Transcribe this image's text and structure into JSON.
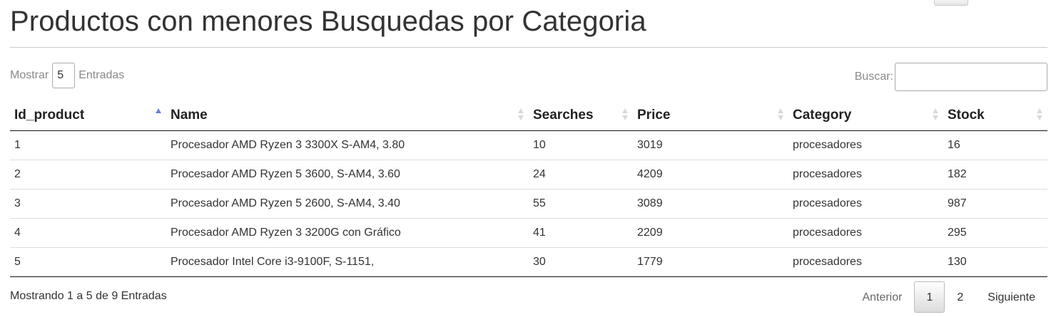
{
  "page": {
    "title": "Productos con menores Busquedas por Categoria"
  },
  "length_control": {
    "prefix": "Mostrar",
    "value": "5",
    "suffix": "Entradas"
  },
  "search": {
    "label": "Buscar:",
    "value": ""
  },
  "table": {
    "columns": [
      {
        "label": "Id_product",
        "sort": "asc"
      },
      {
        "label": "Name",
        "sort": "none"
      },
      {
        "label": "Searches",
        "sort": "none"
      },
      {
        "label": "Price",
        "sort": "none"
      },
      {
        "label": "Category",
        "sort": "none"
      },
      {
        "label": "Stock",
        "sort": "none"
      }
    ],
    "rows": [
      [
        "1",
        "Procesador AMD Ryzen 3 3300X S-AM4, 3.80",
        "10",
        "3019",
        "procesadores",
        "16"
      ],
      [
        "2",
        "Procesador AMD Ryzen 5 3600, S-AM4, 3.60",
        "24",
        "4209",
        "procesadores",
        "182"
      ],
      [
        "3",
        "Procesador AMD Ryzen 5 2600, S-AM4, 3.40",
        "55",
        "3089",
        "procesadores",
        "987"
      ],
      [
        "4",
        "Procesador AMD Ryzen 3 3200G con Gráfico",
        "41",
        "2209",
        "procesadores",
        "295"
      ],
      [
        "5",
        "Procesador Intel Core i3-9100F, S-1151,",
        "30",
        "1779",
        "procesadores",
        "130"
      ]
    ]
  },
  "footer": {
    "info": "Mostrando 1 a 5 de 9 Entradas",
    "pagination": {
      "previous": "Anterior",
      "pages": [
        "1",
        "2"
      ],
      "current": "1",
      "next": "Siguiente"
    }
  }
}
